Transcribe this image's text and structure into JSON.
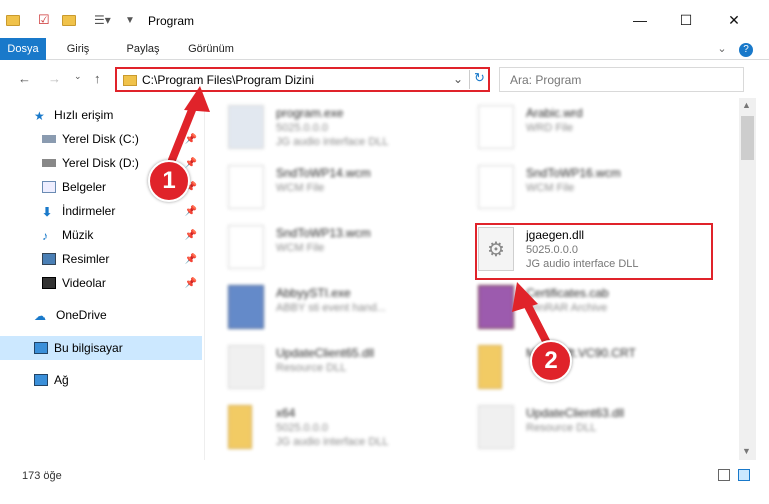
{
  "window": {
    "title": "Program",
    "minimize": "—",
    "maximize": "☐",
    "close": "✕"
  },
  "ribbon": {
    "tabs": [
      "Dosya",
      "Giriş",
      "Paylaş",
      "Görünüm"
    ]
  },
  "address": {
    "path": "C:\\Program Files\\Program Dizini",
    "search_placeholder": "Ara: Program"
  },
  "sidebar": {
    "items": [
      {
        "label": "Hızlı erişim"
      },
      {
        "label": "Yerel Disk (C:)"
      },
      {
        "label": "Yerel Disk (D:)"
      },
      {
        "label": "Belgeler"
      },
      {
        "label": "İndirmeler"
      },
      {
        "label": "Müzik"
      },
      {
        "label": "Resimler"
      },
      {
        "label": "Videolar"
      },
      {
        "label": "OneDrive"
      },
      {
        "label": "Bu bilgisayar"
      },
      {
        "label": "Ağ"
      }
    ]
  },
  "files": [
    {
      "name": "program.exe",
      "line1": "5025.0.0.0",
      "line2": "JG audio interface DLL"
    },
    {
      "name": "Arabic.wrd",
      "line1": "WRD File",
      "line2": ""
    },
    {
      "name": "SndToWP14.wcm",
      "line1": "WCM File",
      "line2": ""
    },
    {
      "name": "SndToWP16.wcm",
      "line1": "WCM File",
      "line2": ""
    },
    {
      "name": "SndToWP13.wcm",
      "line1": "WCM File",
      "line2": ""
    },
    {
      "name": "jgaegen.dll",
      "line1": "5025.0.0.0",
      "line2": "JG audio interface DLL"
    },
    {
      "name": "AbbyySTI.exe",
      "line1": "ABBY sti event hand...",
      "line2": ""
    },
    {
      "name": "Certificates.cab",
      "line1": "WinRAR Archive",
      "line2": ""
    },
    {
      "name": "UpdateClient65.dll",
      "line1": "Resource DLL",
      "line2": ""
    },
    {
      "name": "Microsoft.VC90.CRT",
      "line1": "",
      "line2": ""
    },
    {
      "name": "x64",
      "line1": "5025.0.0.0",
      "line2": "JG audio interface DLL"
    },
    {
      "name": "UpdateClient63.dll",
      "line1": "Resource DLL",
      "line2": ""
    }
  ],
  "status": {
    "count": "173 öğe"
  },
  "callouts": [
    "1",
    "2"
  ],
  "colors": {
    "accent": "#1979ca",
    "highlight": "#e0232a",
    "selected": "#cce8ff"
  }
}
